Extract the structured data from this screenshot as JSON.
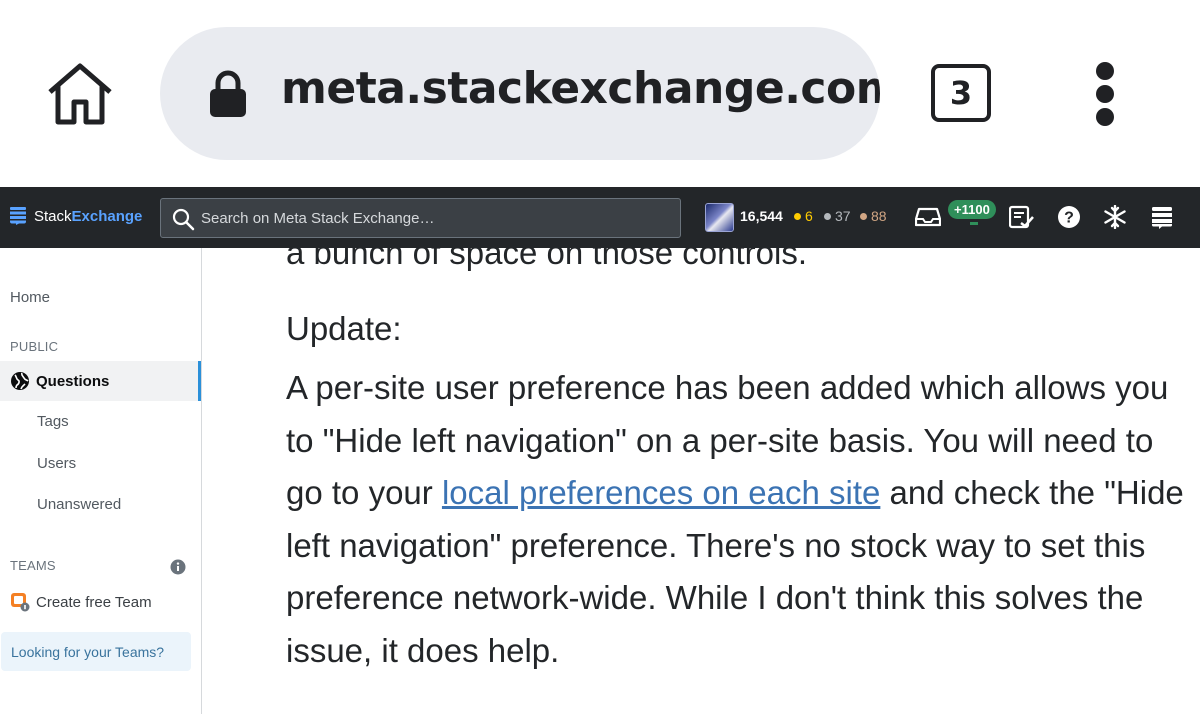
{
  "browser": {
    "url": "meta.stackexchange.com/",
    "tab_count": "3",
    "icons": {
      "home": "home-icon",
      "lock": "lock-icon",
      "menu": "more-vert-icon"
    }
  },
  "topbar": {
    "logo_stack": "Stack",
    "logo_exchange": "Exchange",
    "search_placeholder": "Search on Meta Stack Exchange…",
    "reputation": "16,544",
    "badges": {
      "gold": "6",
      "silver": "37",
      "bronze": "88"
    },
    "achievements": "+1100",
    "colors": {
      "bar": "#232629",
      "exchange_blue": "#59a2ff",
      "gold": "#ffcc01",
      "silver": "#b4b8bc",
      "bronze": "#d1a684",
      "achievement_green": "#2f8f5a"
    }
  },
  "sidebar": {
    "home": "Home",
    "public_header": "PUBLIC",
    "questions": "Questions",
    "tags": "Tags",
    "users": "Users",
    "unanswered": "Unanswered",
    "teams_header": "TEAMS",
    "create_team": "Create free Team",
    "looking_for_teams": "Looking for your Teams?"
  },
  "post": {
    "partial_line": "a bunch of space on those controls.",
    "update_label": "Update:",
    "para_part1": "A per-site user preference has been added which allows you to \"Hide left navigation\" on a per-site basis. You will need to go to your ",
    "link_text": "local preferences on each site",
    "para_part2": " and check the \"Hide left navigation\" preference. There's no stock way to set this preference network-wide. While I don't think this solves the issue, it does help."
  }
}
